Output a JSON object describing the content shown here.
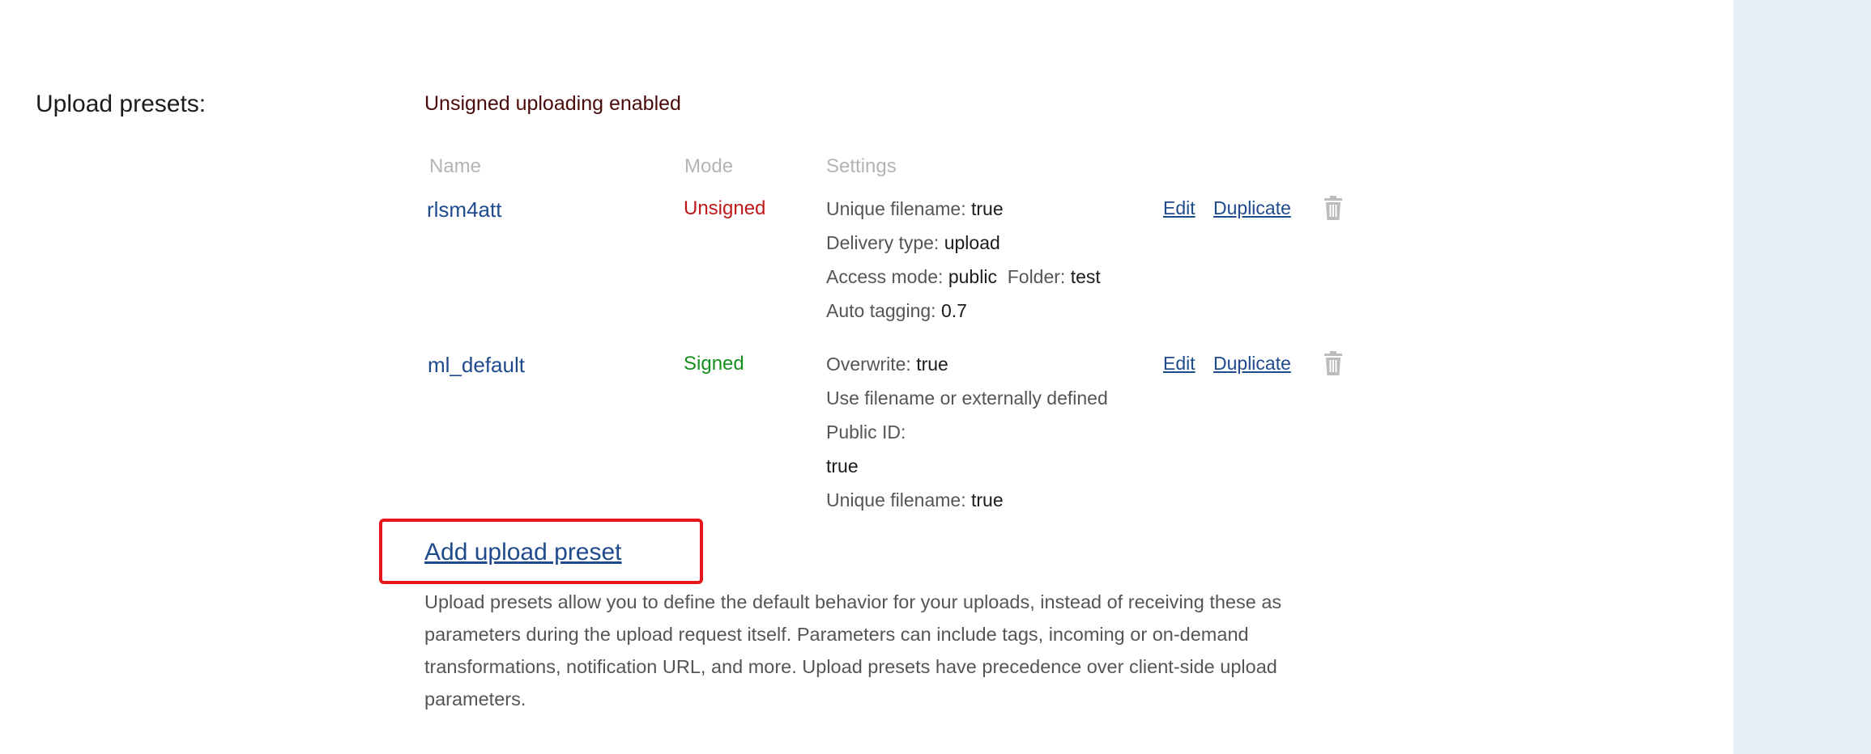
{
  "section": {
    "label": "Upload presets:",
    "unsigned_note": "Unsigned uploading enabled"
  },
  "table": {
    "headers": {
      "name": "Name",
      "mode": "Mode",
      "settings": "Settings"
    },
    "rows": [
      {
        "name": "rlsm4att",
        "mode": "Unsigned",
        "settings": {
          "unique_filename_label": "Unique filename:",
          "unique_filename_value": "true",
          "delivery_type_label": "Delivery type:",
          "delivery_type_value": "upload",
          "access_mode_label": "Access mode:",
          "access_mode_value": "public",
          "folder_label": "Folder:",
          "folder_value": "test",
          "auto_tagging_label": "Auto tagging:",
          "auto_tagging_value": "0.7"
        },
        "edit_label": "Edit",
        "duplicate_label": "Duplicate"
      },
      {
        "name": "ml_default",
        "mode": "Signed",
        "settings": {
          "overwrite_label": "Overwrite:",
          "overwrite_value": "true",
          "use_filename_label_1": "Use filename or externally defined",
          "use_filename_label_2": "Public ID:",
          "use_filename_value": "true",
          "unique_filename_label": "Unique filename:",
          "unique_filename_value": "true"
        },
        "edit_label": "Edit",
        "duplicate_label": "Duplicate"
      }
    ]
  },
  "add_preset_label": "Add upload preset",
  "description": "Upload presets allow you to define the default behavior for your uploads, instead of receiving these as parameters during the upload request itself. Parameters can include tags, incoming or on-demand transformations, notification URL, and more. Upload presets have precedence over client-side upload parameters.",
  "icons": {
    "delete": "trash-icon"
  },
  "colors": {
    "link": "#1f4a8c",
    "unsigned": "#c01818",
    "signed": "#14901e",
    "highlight": "#e4161c",
    "side_panel": "#e6edf5"
  }
}
